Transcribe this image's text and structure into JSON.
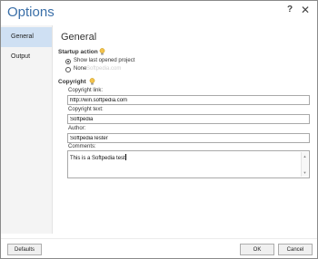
{
  "window": {
    "title": "Options",
    "help_glyph": "?",
    "close_glyph": "✕"
  },
  "sidebar": {
    "items": [
      {
        "label": "General",
        "active": true
      },
      {
        "label": "Output",
        "active": false
      }
    ]
  },
  "main": {
    "heading": "General",
    "startup": {
      "title": "Startup action",
      "options": [
        {
          "label": "Show last opened project",
          "selected": true
        },
        {
          "label": "None",
          "selected": false
        }
      ],
      "ghost_text": "Softpedia.com"
    },
    "copyright": {
      "title": "Copyright",
      "link_label": "Copyright link:",
      "link_value": "http://win.softpedia.com",
      "text_label": "Copyright text:",
      "text_value": "Softpedia",
      "author_label": "Author:",
      "author_value": "SoftpediaTester",
      "comments_label": "Comments:",
      "comments_value": "This is a Softpedia test"
    }
  },
  "footer": {
    "defaults_label": "Defaults",
    "ok_label": "OK",
    "cancel_label": "Cancel"
  },
  "colors": {
    "accent": "#3a6fa8",
    "selected_nav": "#cfe0f3",
    "bulb": "#f2c24b"
  }
}
